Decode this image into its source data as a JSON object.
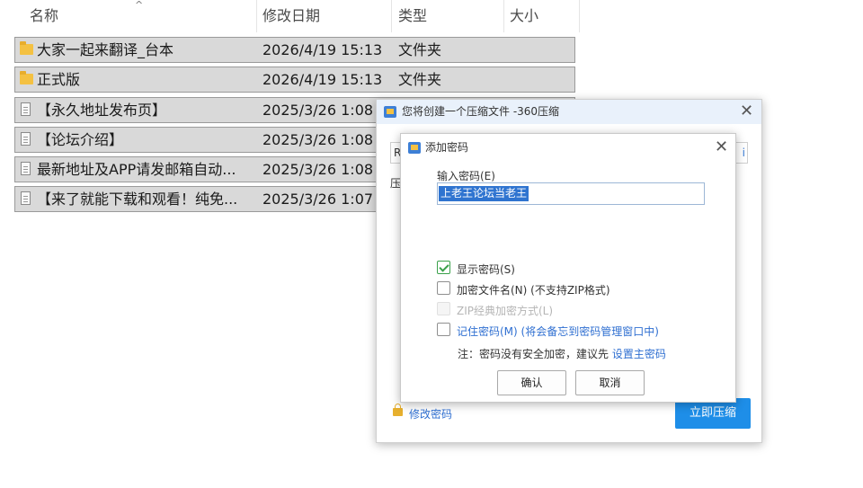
{
  "explorer": {
    "columns": {
      "name": "名称",
      "modified": "修改日期",
      "type": "类型",
      "size": "大小"
    },
    "sort_arrow": "^",
    "rows": [
      {
        "icon": "folder-icon",
        "name": "大家一起来翻译_台本",
        "modified": "2026/4/19 15:13",
        "type": "文件夹"
      },
      {
        "icon": "folder-icon",
        "name": "正式版",
        "modified": "2026/4/19 15:13",
        "type": "文件夹"
      },
      {
        "icon": "document-icon",
        "name": "【永久地址发布页】",
        "modified": "2025/3/26 1:08",
        "type": ""
      },
      {
        "icon": "document-icon",
        "name": "【论坛介绍】",
        "modified": "2025/3/26 1:08",
        "type": ""
      },
      {
        "icon": "document-icon",
        "name": "最新地址及APP请发邮箱自动...",
        "modified": "2025/3/26 1:08",
        "type": ""
      },
      {
        "icon": "document-icon",
        "name": "【来了就能下载和观看！纯免...",
        "modified": "2025/3/26 1:07",
        "type": ""
      }
    ]
  },
  "outer_dialog": {
    "title": "您将创建一个压缩文件 -360压缩",
    "close": "✕",
    "path_fragment": "R",
    "path_end": "i",
    "cut_label": "压",
    "change_password": "修改密码",
    "compress_button": "立即压缩"
  },
  "password_dialog": {
    "title": "添加密码",
    "close": "✕",
    "input_label": "输入密码(E)",
    "password_value": "上老王论坛当老王",
    "options": {
      "show_password": "显示密码(S)",
      "encrypt_filenames": "加密文件名(N) (不支持ZIP格式)",
      "zip_classic": "ZIP经典加密方式(L)",
      "remember_password": "记住密码(M) (将会备忘到密码管理窗口中)"
    },
    "note_prefix": "注：密码没有安全加密，建议先",
    "note_link": "设置主密码",
    "ok_button": "确认",
    "cancel_button": "取消"
  }
}
